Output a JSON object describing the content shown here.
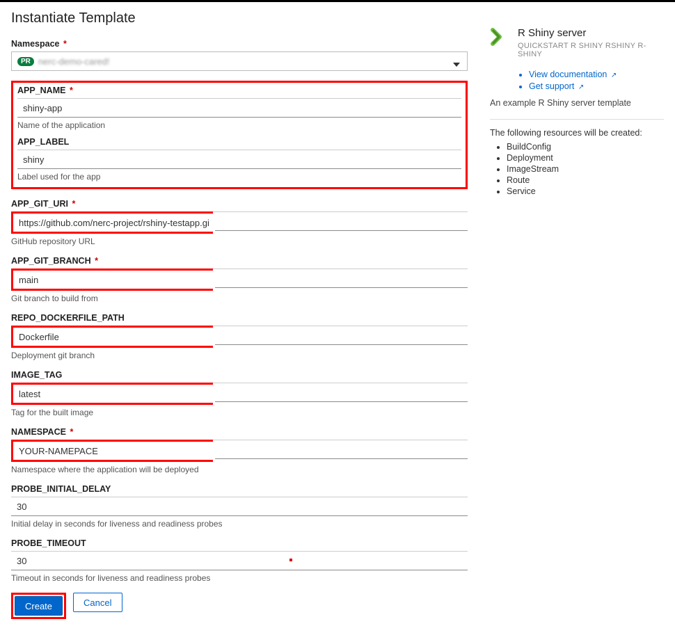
{
  "page": {
    "title": "Instantiate Template"
  },
  "namespace": {
    "label": "Namespace",
    "badge": "PR",
    "selected": "nerc-demo-cared!"
  },
  "fields": {
    "app_name": {
      "label": "APP_NAME",
      "value": "shiny-app",
      "help": "Name of the application",
      "required": true
    },
    "app_label": {
      "label": "APP_LABEL",
      "value": "shiny",
      "help": "Label used for the app",
      "required": false
    },
    "app_git_uri": {
      "label": "APP_GIT_URI",
      "value": "https://github.com/nerc-project/rshiny-testapp.git",
      "help": "GitHub repository URL",
      "required": true
    },
    "git_branch": {
      "label": "APP_GIT_BRANCH",
      "value": "main",
      "help": "Git branch to build from",
      "required": true
    },
    "dockerfile": {
      "label": "REPO_DOCKERFILE_PATH",
      "value": "Dockerfile",
      "help": "Deployment git branch",
      "required": false
    },
    "image_tag": {
      "label": "IMAGE_TAG",
      "value": "latest",
      "help": "Tag for the built image",
      "required": false
    },
    "ns": {
      "label": "NAMESPACE",
      "value": "YOUR-NAMEPACE",
      "help": "Namespace where the application will be deployed",
      "required": true
    },
    "probe_delay": {
      "label": "PROBE_INITIAL_DELAY",
      "value": "30",
      "help": "Initial delay in seconds for liveness and readiness probes",
      "required": false
    },
    "probe_to": {
      "label": "PROBE_TIMEOUT",
      "value": "30",
      "help": "Timeout in seconds for liveness and readiness probes",
      "required": false
    }
  },
  "actions": {
    "create": "Create",
    "cancel": "Cancel"
  },
  "sidebar": {
    "title": "R Shiny server",
    "tags": "QUICKSTART R SHINY RSHINY R-SHINY",
    "links": {
      "doc": "View documentation",
      "support": "Get support"
    },
    "desc": "An example R Shiny server template",
    "res_intro": "The following resources will be created:",
    "resources": [
      "BuildConfig",
      "Deployment",
      "ImageStream",
      "Route",
      "Service"
    ]
  }
}
